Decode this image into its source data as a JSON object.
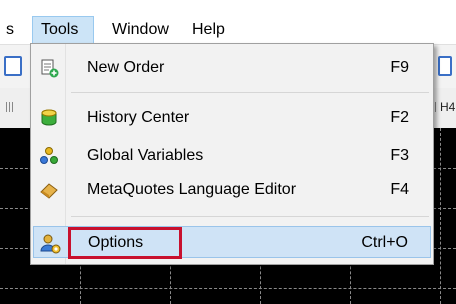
{
  "menubar": {
    "items": [
      {
        "label": "s"
      },
      {
        "label": "Tools"
      },
      {
        "label": "Window"
      },
      {
        "label": "Help"
      }
    ]
  },
  "background": {
    "timeframe_label": "H4"
  },
  "tools_menu": {
    "items": [
      {
        "label": "New Order",
        "shortcut": "F9",
        "icon": "new-order-icon"
      },
      {
        "label": "History Center",
        "shortcut": "F2",
        "icon": "history-center-icon"
      },
      {
        "label": "Global Variables",
        "shortcut": "F3",
        "icon": "global-variables-icon"
      },
      {
        "label": "MetaQuotes Language Editor",
        "shortcut": "F4",
        "icon": "metaeditor-icon"
      },
      {
        "label": "Options",
        "shortcut": "Ctrl+O",
        "icon": "options-icon"
      }
    ]
  },
  "colors": {
    "highlight": "#cfe3f6",
    "annotation_box": "#c8102e",
    "chart_background": "#000000"
  }
}
